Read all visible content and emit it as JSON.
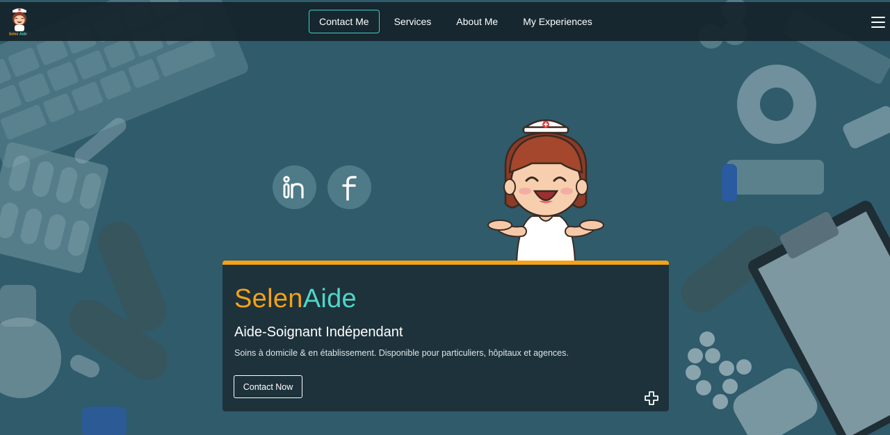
{
  "brand": {
    "logo_icon": "nurse-mascot-logo-icon",
    "part1": "Selen",
    "part2": "Aide",
    "color_part1": "#f5a216",
    "color_part2": "#4fd6c8"
  },
  "nav": {
    "items": [
      {
        "label": "Contact Me",
        "active": true
      },
      {
        "label": "Services",
        "active": false
      },
      {
        "label": "About Me",
        "active": false
      },
      {
        "label": "My Experiences",
        "active": false
      }
    ],
    "menu_icon": "hamburger-menu-icon",
    "active_border_color": "#3fd3c4"
  },
  "social": [
    {
      "icon": "linkedin-icon"
    },
    {
      "icon": "facebook-icon"
    }
  ],
  "hero": {
    "illustration": "nurse-character-illustration",
    "subtitle": "Aide-Soignant Indépendant",
    "description": "Soins à domicile & en établissement. Disponible pour particuliers, hôpitaux et agences.",
    "cta_label": "Contact Now",
    "corner_icon": "medical-cross-icon",
    "accent_color": "#f5a216"
  }
}
